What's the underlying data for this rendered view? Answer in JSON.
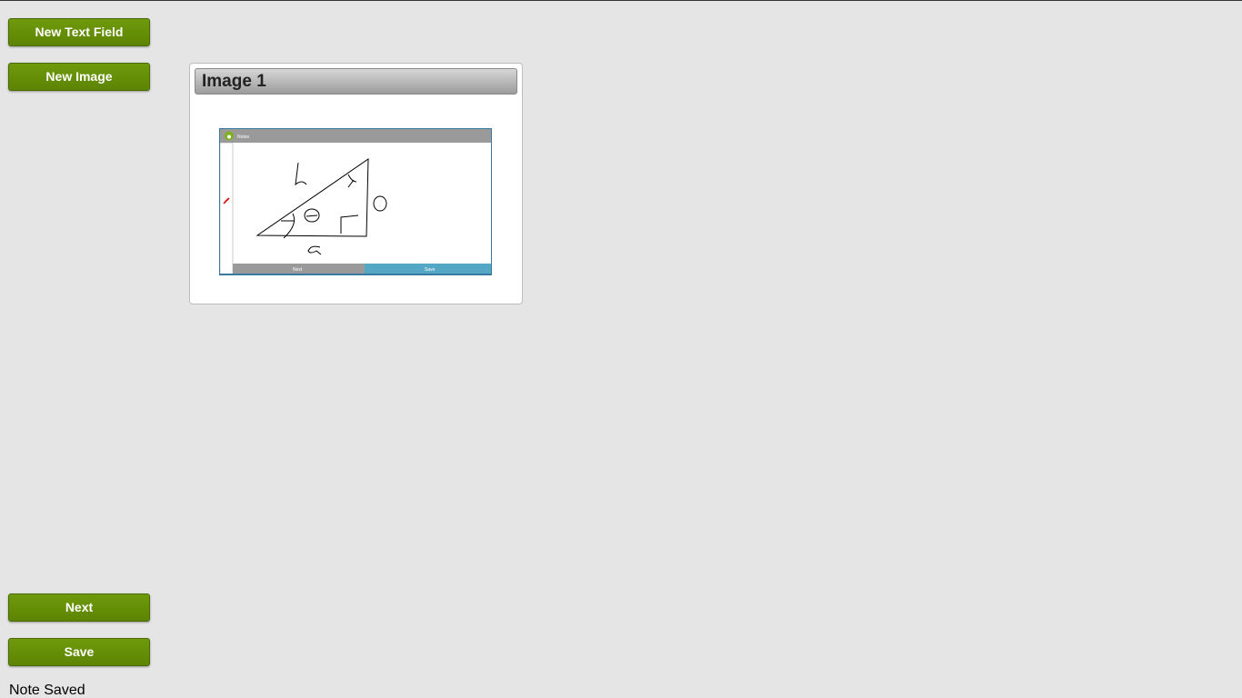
{
  "toolbar": {
    "new_text_field_label": "New Text Field",
    "new_image_label": "New Image"
  },
  "footer": {
    "next_label": "Next",
    "save_label": "Save",
    "status_text": "Note Saved"
  },
  "image_card": {
    "title": "Image 1",
    "thumbnail": {
      "app_title": "Notes",
      "next_label": "Next",
      "save_label": "Save",
      "handwritten_labels": [
        "h",
        "o",
        "a",
        "x",
        "θ"
      ]
    }
  },
  "colors": {
    "button_green": "#628f05",
    "background": "#e5e5e5"
  }
}
